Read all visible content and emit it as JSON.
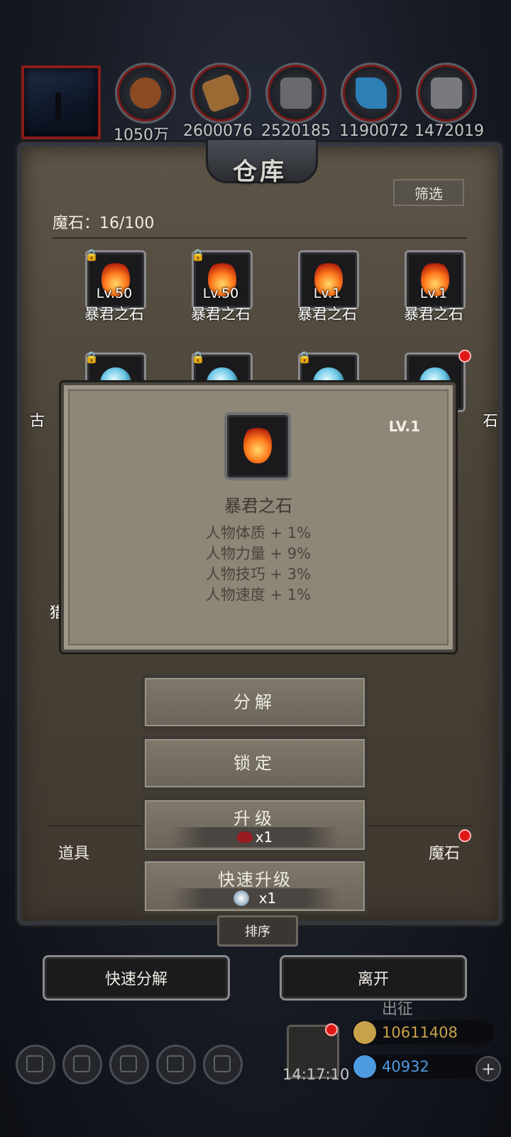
{
  "resources": [
    {
      "name": "wood-log",
      "value": "1050万",
      "color": "#8a4a22"
    },
    {
      "name": "planks",
      "value": "2600076",
      "color": "#9a6a34"
    },
    {
      "name": "iron-ingot",
      "value": "2520185",
      "color": "#6a6a6e"
    },
    {
      "name": "crystal",
      "value": "1190072",
      "color": "#2e7fb6"
    },
    {
      "name": "steel-plate",
      "value": "1472019",
      "color": "#7a7a7e"
    }
  ],
  "warehouse": {
    "title": "仓库",
    "filter_label": "筛选",
    "count_label": "魔石：16/100",
    "items": [
      {
        "level": "Lv.50",
        "name": "暴君之石",
        "kind": "flame",
        "locked": true
      },
      {
        "level": "Lv.50",
        "name": "暴君之石",
        "kind": "flame",
        "locked": true
      },
      {
        "level": "Lv.1",
        "name": "暴君之石",
        "kind": "flame",
        "locked": false
      },
      {
        "level": "Lv.1",
        "name": "暴君之石",
        "kind": "flame",
        "locked": false
      },
      {
        "name": "古",
        "kind": "orb",
        "locked": true
      },
      {
        "kind": "orb",
        "locked": true
      },
      {
        "kind": "orb",
        "locked": true
      },
      {
        "name": "石",
        "kind": "orb",
        "locked": false,
        "badge": true
      }
    ],
    "hidden_row_label": "猎",
    "tabs": {
      "left": "道具",
      "right": "魔石"
    }
  },
  "popup": {
    "level": "LV.1",
    "name": "暴君之石",
    "stats": [
      "人物体质 + 1%",
      "人物力量 + 9%",
      "人物技巧 + 3%",
      "人物速度 + 1%"
    ]
  },
  "actions": {
    "decompose": "分解",
    "lock": "锁定",
    "upgrade": "升级",
    "upgrade_cost": "x1",
    "quick_upgrade": "快速升级",
    "quick_upgrade_cost": "x1"
  },
  "sort_label": "排序",
  "quick_decompose_label": "快速分解",
  "leave_label": "离开",
  "hud": {
    "expedition_label": "出征",
    "gold": "10611408",
    "diamond": "40932",
    "time": "14:17:10",
    "colors": {
      "gold": "#c8a24a",
      "diamond": "#4e9be0"
    }
  }
}
